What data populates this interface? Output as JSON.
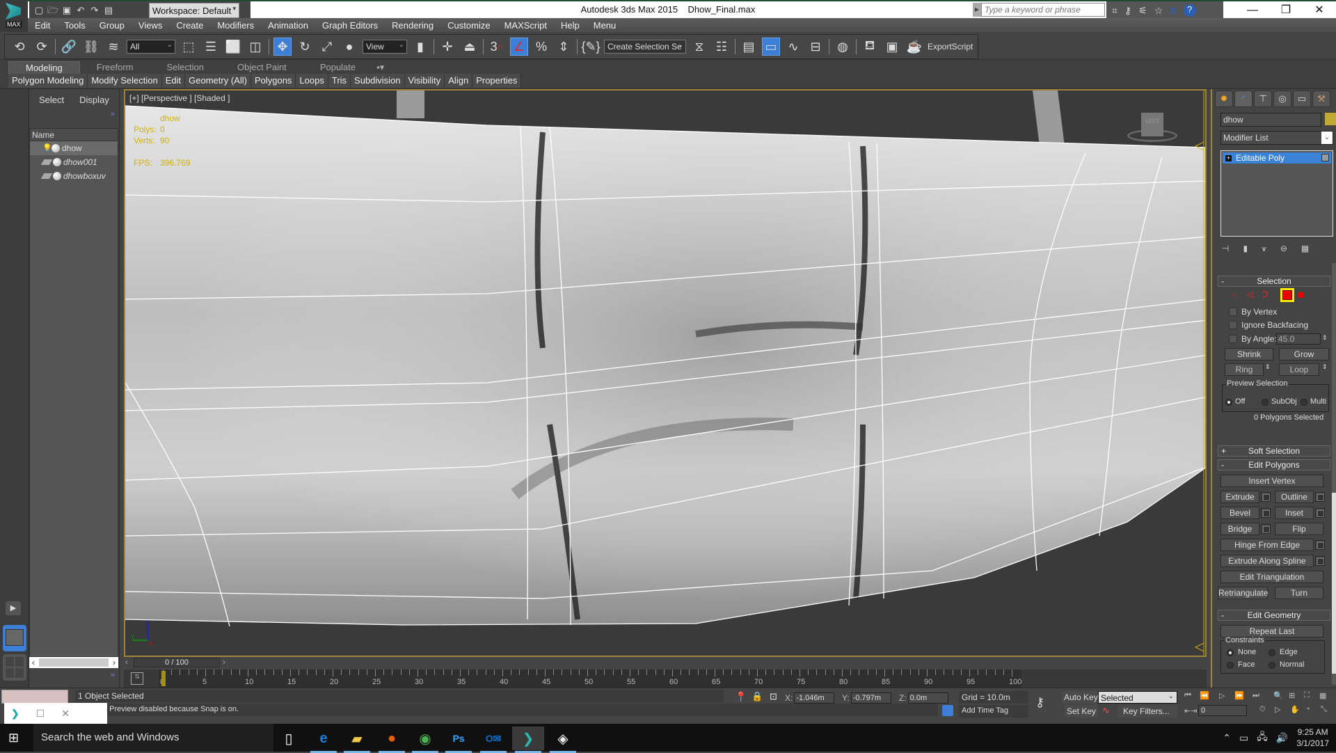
{
  "titlebar": {
    "app_title": "Autodesk 3ds Max  2015",
    "file_name": "Dhow_Final.max",
    "workspace": "Workspace: Default",
    "search_placeholder": "Type a keyword or phrase",
    "logo_text": "MAX"
  },
  "menu": [
    "Edit",
    "Tools",
    "Group",
    "Views",
    "Create",
    "Modifiers",
    "Animation",
    "Graph Editors",
    "Rendering",
    "Customize",
    "MAXScript",
    "Help",
    "Menu"
  ],
  "toolbar": {
    "selection_filter": "All",
    "ref_coord": "View",
    "named_selection": "Create Selection Se",
    "export_script": "ExportScript",
    "snap_3": "3"
  },
  "ribbon": {
    "tabs": [
      "Modeling",
      "Freeform",
      "Selection",
      "Object Paint",
      "Populate"
    ],
    "active_tab": "Modeling",
    "panels": [
      "Polygon Modeling",
      "Modify Selection",
      "Edit",
      "Geometry (All)",
      "Polygons",
      "Loops",
      "Tris",
      "Subdivision",
      "Visibility",
      "Align",
      "Properties"
    ]
  },
  "scene_explorer": {
    "tabs": [
      "Select",
      "Display"
    ],
    "column_header": "Name",
    "items": [
      {
        "name": "dhow",
        "selected": true
      },
      {
        "name": "dhow001",
        "selected": false
      },
      {
        "name": "dhowboxuv",
        "selected": false
      }
    ]
  },
  "viewport": {
    "label": "[+] [Perspective ] [Shaded ]",
    "stats": {
      "object": "dhow",
      "polys_label": "Polys:",
      "polys": "0",
      "verts_label": "Verts:",
      "verts": "90",
      "fps_label": "FPS:",
      "fps": "396.769"
    },
    "viewcube_label": "LEFT",
    "axis": {
      "x": "X",
      "y": "Y",
      "z": "Z"
    }
  },
  "timeline": {
    "slider": "0 / 100",
    "current_frame": 0,
    "start": 0,
    "end": 100,
    "labels": [
      "0",
      "5",
      "10",
      "15",
      "20",
      "25",
      "30",
      "35",
      "40",
      "45",
      "50",
      "55",
      "60",
      "65",
      "70",
      "75",
      "80",
      "85",
      "90",
      "95",
      "100"
    ]
  },
  "status": {
    "selection": "1 Object Selected",
    "prompt": "t: Preview disabled because Snap is on.",
    "x_label": "X:",
    "x": "-1.046m",
    "y_label": "Y:",
    "y": "-0.797m",
    "z_label": "Z:",
    "z": "0.0m",
    "grid": "Grid = 10.0m",
    "add_time_tag": "Add Time Tag",
    "auto_key": "Auto Key",
    "set_key": "Set Key",
    "key_mode": "Selected",
    "key_filters": "Key Filters...",
    "frame": "0"
  },
  "command_panel": {
    "object_name": "dhow",
    "object_color": "#c1a831",
    "modifier_list": "Modifier List",
    "stack": [
      "Editable Poly"
    ],
    "selection": {
      "title": "Selection",
      "by_vertex": "By Vertex",
      "ignore_backfacing": "Ignore Backfacing",
      "by_angle": "By Angle:",
      "angle_value": "45.0",
      "shrink": "Shrink",
      "grow": "Grow",
      "ring": "Ring",
      "loop": "Loop",
      "preview_title": "Preview Selection",
      "preview_options": [
        "Off",
        "SubObj",
        "Multi"
      ],
      "preview_selected": "Off",
      "count": "0 Polygons Selected"
    },
    "soft_selection": "Soft Selection",
    "edit_polygons": {
      "title": "Edit Polygons",
      "insert_vertex": "Insert Vertex",
      "extrude": "Extrude",
      "outline": "Outline",
      "bevel": "Bevel",
      "inset": "Inset",
      "bridge": "Bridge",
      "flip": "Flip",
      "hinge": "Hinge From Edge",
      "extrude_spline": "Extrude Along Spline",
      "edit_triangulation": "Edit Triangulation",
      "retriangulate": "Retriangulate",
      "turn": "Turn"
    },
    "edit_geometry": {
      "title": "Edit Geometry",
      "repeat_last": "Repeat Last",
      "constraints_title": "Constraints",
      "constraints": [
        "None",
        "Edge",
        "Face",
        "Normal"
      ],
      "constraint_selected": "None"
    }
  },
  "taskbar": {
    "search": "Search the web and Windows",
    "time": "9:25 AM",
    "date": "3/1/2017"
  }
}
